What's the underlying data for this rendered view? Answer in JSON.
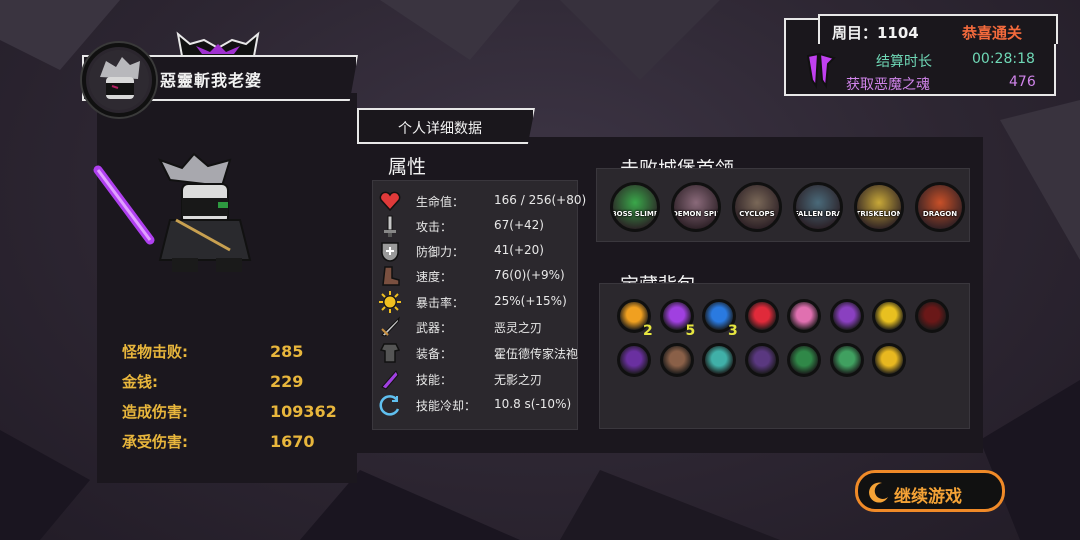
{
  "player": {
    "name": "惡靈斬我老婆"
  },
  "summary": {
    "round_label": "周目：1104",
    "clear_label": "恭喜通关",
    "time_label": "结算时长",
    "time_value": "00:28:18",
    "soul_label": "获取恶魔之魂",
    "soul_value": "476"
  },
  "stats": [
    {
      "label": "怪物击败:",
      "value": "285"
    },
    {
      "label": "金钱:",
      "value": "229"
    },
    {
      "label": "造成伤害:",
      "value": "109362"
    },
    {
      "label": "承受伤害:",
      "value": "1670"
    }
  ],
  "detail_tab": "个人详细数据",
  "attributes": {
    "title": "属性",
    "rows": [
      {
        "icon": "heart-icon",
        "label": "生命值：",
        "value": "166 / 256(+80)"
      },
      {
        "icon": "sword-icon",
        "label": "攻击：",
        "value": "67(+42)"
      },
      {
        "icon": "shield-icon",
        "label": "防御力：",
        "value": "41(+20)"
      },
      {
        "icon": "boot-icon",
        "label": "速度：",
        "value": "76(0)(+9%)"
      },
      {
        "icon": "sun-icon",
        "label": "暴击率：",
        "value": "25%(+15%)"
      },
      {
        "icon": "weapon-icon",
        "label": "武器：",
        "value": "恶灵之刃"
      },
      {
        "icon": "armor-icon",
        "label": "装备：",
        "value": "霍伍德传家法袍"
      },
      {
        "icon": "skill-icon",
        "label": "技能：",
        "value": "无影之刃"
      },
      {
        "icon": "cooldown-icon",
        "label": "技能冷却：",
        "value": "10.8 s(-10%)"
      }
    ]
  },
  "bosses": {
    "title": "击败城堡首领",
    "items": [
      {
        "name": "BOSS SLIME",
        "color": "#3aa84a"
      },
      {
        "name": "DEMON SPIDER",
        "color": "#8a6a7a"
      },
      {
        "name": "CYCLOPS",
        "color": "#7a6858"
      },
      {
        "name": "FALLEN DRAGON",
        "color": "#4a6a7a"
      },
      {
        "name": "TRISKELION",
        "color": "#c8a838"
      },
      {
        "name": "DRAGON",
        "color": "#c85028"
      }
    ]
  },
  "bag": {
    "title": "宝藏背包",
    "items": [
      {
        "icon": "fire-crystal-icon",
        "color": "#f0a020",
        "count": "2"
      },
      {
        "icon": "purple-crystal-icon",
        "color": "#a040e0",
        "count": "5"
      },
      {
        "icon": "blue-crystal-icon",
        "color": "#2a7ae0",
        "count": "3"
      },
      {
        "icon": "red-crystal-icon",
        "color": "#e02a3a",
        "count": ""
      },
      {
        "icon": "pink-flower-icon",
        "color": "#e070b0",
        "count": ""
      },
      {
        "icon": "purple-leaf-icon",
        "color": "#8a40c0",
        "count": ""
      },
      {
        "icon": "gold-ring-icon",
        "color": "#e8c020",
        "count": ""
      },
      {
        "icon": "dark-claw-icon",
        "color": "#6a1818",
        "count": ""
      },
      {
        "icon": "purple-horn-icon",
        "color": "#6a30a0",
        "count": ""
      },
      {
        "icon": "beast-mask-icon",
        "color": "#8a6048",
        "count": ""
      },
      {
        "icon": "teal-gear-icon",
        "color": "#40b0a8",
        "count": ""
      },
      {
        "icon": "purple-wing-icon",
        "color": "#5a3880",
        "count": ""
      },
      {
        "icon": "green-claw-icon",
        "color": "#308848",
        "count": ""
      },
      {
        "icon": "green-helm-icon",
        "color": "#40a060",
        "count": ""
      },
      {
        "icon": "gold-boot-icon",
        "color": "#e8b820",
        "count": ""
      }
    ]
  },
  "continue_button": "继续游戏"
}
